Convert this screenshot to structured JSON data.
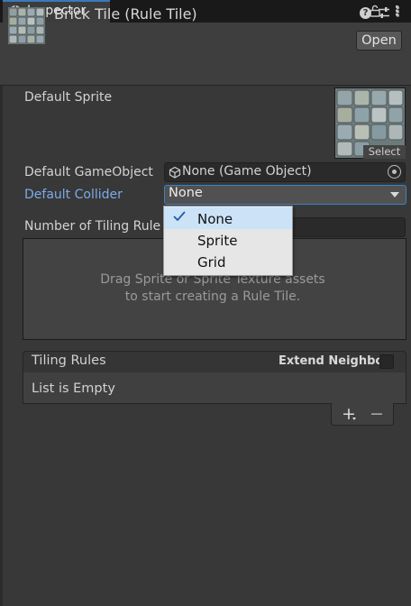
{
  "tab": {
    "title": "Inspector",
    "icon": "info-icon"
  },
  "header": {
    "title": "Brick Tile (Rule Tile)",
    "open_label": "Open",
    "icons": [
      "tile-thumbnail-icon",
      "help-icon",
      "preset-sliders-icon",
      "kebab-menu-icon"
    ]
  },
  "fields": {
    "default_sprite_label": "Default Sprite",
    "sprite_select_label": "Select",
    "default_gameobject_label": "Default GameObject",
    "default_gameobject_value": "None (Game Object)",
    "default_collider_label": "Default Collider",
    "default_collider_value": "None",
    "tiling_rules_count_label": "Number of Tiling Rule"
  },
  "drop_area": {
    "text": "Drag Sprite or Sprite Texture assets\n to start creating a Rule Tile."
  },
  "tiling_rules": {
    "title": "Tiling Rules",
    "extend_neighbor_label": "Extend Neighbor",
    "extend_neighbor_checked": false,
    "empty_text": "List is Empty",
    "add_label": "+",
    "remove_label": "−"
  },
  "collider_popup": {
    "options": [
      {
        "label": "None",
        "selected": true
      },
      {
        "label": "Sprite",
        "selected": false
      },
      {
        "label": "Grid",
        "selected": false
      }
    ]
  },
  "colors": {
    "accent": "#3a79bb",
    "label_highlight": "#7aabe8",
    "popup_selected": "#cce2f7"
  }
}
